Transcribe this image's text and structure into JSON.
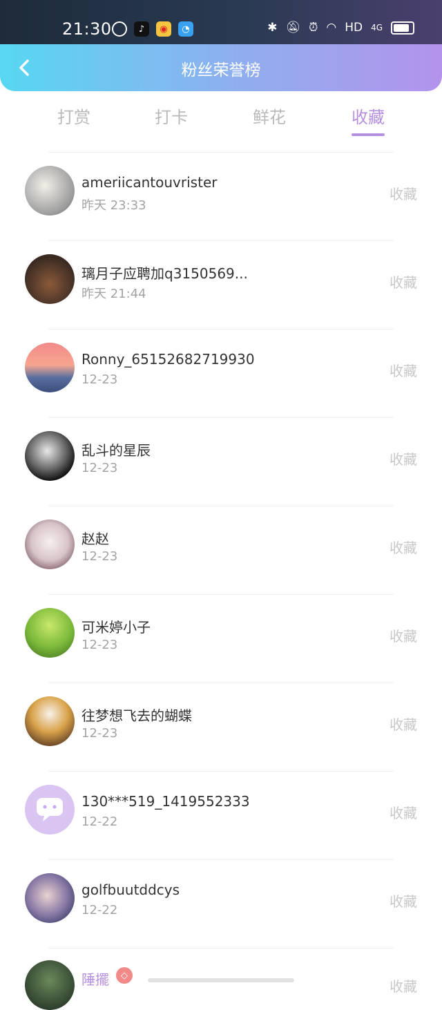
{
  "status_bar": {
    "time": "21:30",
    "network": "HD",
    "cell": "4G"
  },
  "header": {
    "title": "粉丝荣誉榜"
  },
  "tabs": [
    {
      "label": "打赏",
      "active": false
    },
    {
      "label": "打卡",
      "active": false
    },
    {
      "label": "鲜花",
      "active": false
    },
    {
      "label": "收藏",
      "active": true
    }
  ],
  "list": [
    {
      "name": "ameriicantouvrister",
      "time": "昨天 23:33",
      "action": "收藏"
    },
    {
      "name": "璃月子应聘加q3150569...",
      "time": "昨天 21:44",
      "action": "收藏"
    },
    {
      "name": "Ronny_65152682719930",
      "time": "12-23",
      "action": "收藏"
    },
    {
      "name": "乱斗的星辰",
      "time": "12-23",
      "action": "收藏"
    },
    {
      "name": "赵赵",
      "time": "12-23",
      "action": "收藏"
    },
    {
      "name": "可米婷小子",
      "time": "12-23",
      "action": "收藏"
    },
    {
      "name": "往梦想飞去的蝴蝶",
      "time": "12-23",
      "action": "收藏"
    },
    {
      "name": "130***519_1419552333",
      "time": "12-22",
      "action": "收藏"
    },
    {
      "name": "golfbuutddcys",
      "time": "12-22",
      "action": "收藏"
    },
    {
      "name": "陲擺",
      "time": "",
      "action": "收藏"
    }
  ],
  "colors": {
    "accent": "#b68fe0",
    "header_start": "#57d7f2",
    "header_end": "#b393ec"
  }
}
